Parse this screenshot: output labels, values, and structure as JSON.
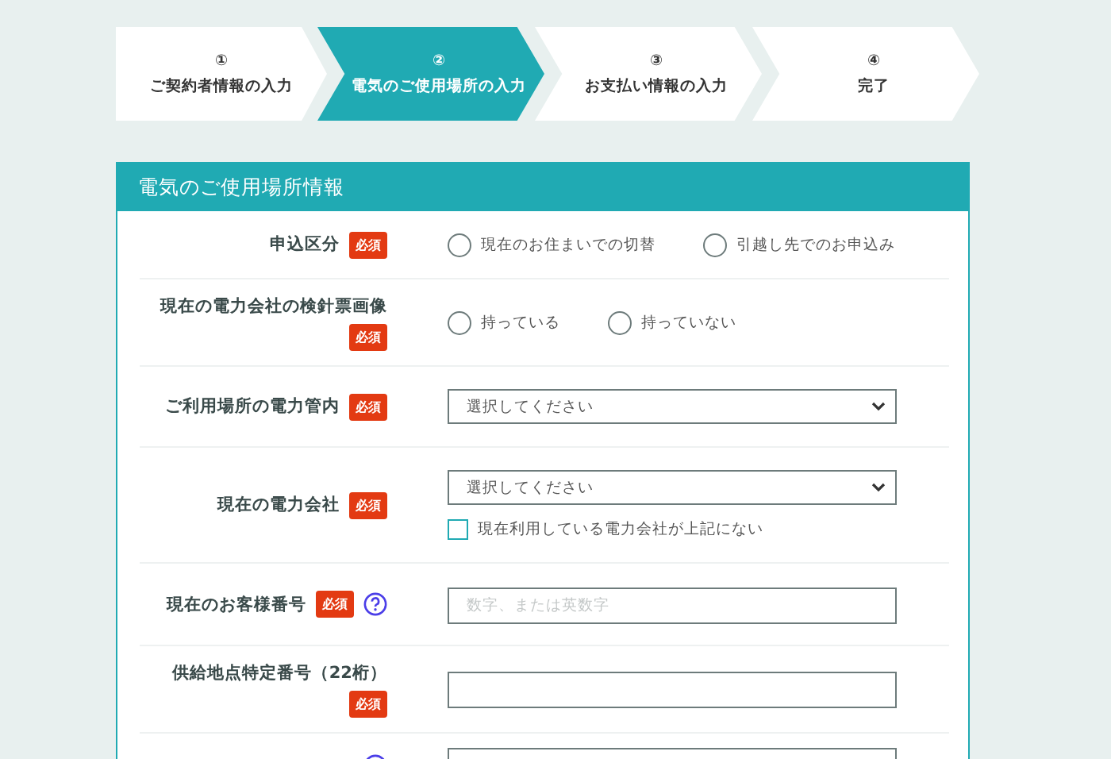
{
  "steps": [
    {
      "number": "①",
      "label": "ご契約者情報の入力",
      "selected": false
    },
    {
      "number": "②",
      "label": "電気のご使用場所の入力",
      "selected": true
    },
    {
      "number": "③",
      "label": "お支払い情報の入力",
      "selected": false
    },
    {
      "number": "④",
      "label": "完了",
      "selected": false
    }
  ],
  "section": {
    "title": "電気のご使用場所情報",
    "rows": [
      {
        "kind": "radio",
        "label": "申込区分",
        "required": "必須",
        "help": false,
        "options": [
          {
            "label": "現在のお住まいでの切替",
            "selected": false
          },
          {
            "label": "引越し先でのお申込み",
            "selected": false
          }
        ]
      },
      {
        "kind": "radio",
        "label": "現在の電力会社の検針票画像",
        "required": "必須",
        "help": false,
        "options": [
          {
            "label": "持っている",
            "selected": false
          },
          {
            "label": "持っていない",
            "selected": false
          }
        ]
      },
      {
        "kind": "select",
        "label": "ご利用場所の電力管内",
        "required": "必須",
        "help": false,
        "value": "選択してください"
      },
      {
        "kind": "select",
        "label": "現在の電力会社",
        "required": "必須",
        "help": false,
        "value": "選択してください",
        "checkbox": {
          "label": "現在利用している電力会社が上記にない",
          "checked": false
        }
      },
      {
        "kind": "text",
        "label": "現在のお客様番号",
        "required": "必須",
        "help": true,
        "placeholder": "数字、または英数字"
      },
      {
        "kind": "text",
        "label": "供給地点特定番号（22桁）",
        "required": "必須",
        "help": false
      },
      {
        "kind": "text",
        "help": true
      }
    ]
  }
}
